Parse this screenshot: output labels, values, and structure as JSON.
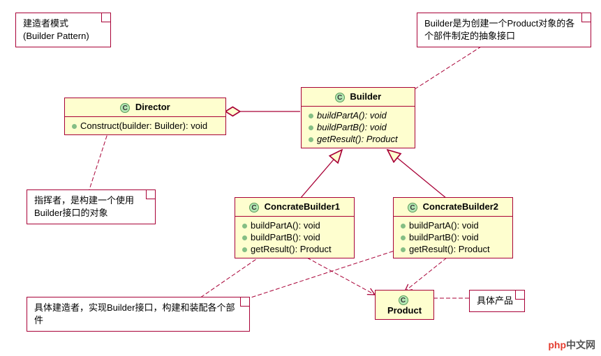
{
  "title_note": {
    "line1": "建造者模式",
    "line2": "(Builder Pattern)"
  },
  "builder_note": "Builder是为创建一个Product对象的各个部件制定的抽象接口",
  "director_note": "指挥者，是构建一个使用Builder接口的对象",
  "concrete_note": "具体建造者，实现Builder接口，构建和装配各个部件",
  "product_note": "具体产品",
  "classes": {
    "director": {
      "name": "Director",
      "members": [
        "Construct(builder: Builder): void"
      ]
    },
    "builder": {
      "name": "Builder",
      "members": [
        "buildPartA(): void",
        "buildPartB(): void",
        "getResult(): Product"
      ]
    },
    "concrete1": {
      "name": "ConcrateBuilder1",
      "members": [
        "buildPartA(): void",
        "buildPartB(): void",
        "getResult(): Product"
      ]
    },
    "concrete2": {
      "name": "ConcrateBuilder2",
      "members": [
        "buildPartA(): void",
        "buildPartB(): void",
        "getResult(): Product"
      ]
    },
    "product": {
      "name": "Product"
    }
  },
  "watermark": {
    "php": "php",
    "rest": "中文网"
  }
}
